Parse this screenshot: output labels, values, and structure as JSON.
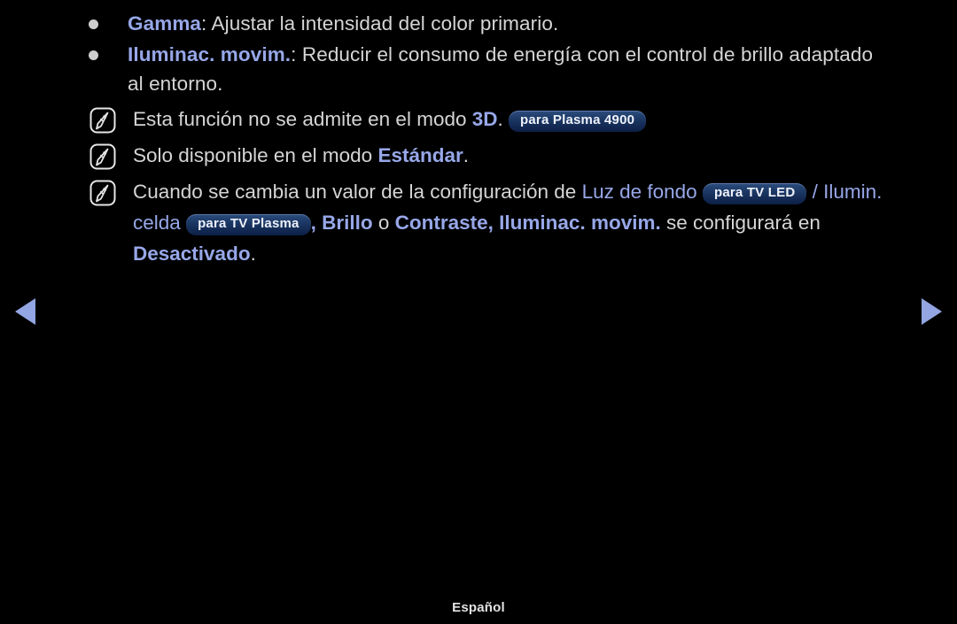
{
  "page": {
    "language_label": "Español",
    "accent_color": "#97a7e8",
    "body_color": "#d5d5d5",
    "background_color": "#000000",
    "badge_color": "#1b3763",
    "arrow_color": "#93a5e2"
  },
  "nav": {
    "prev_label": "◀",
    "next_label": "▶",
    "prev_name": "previous-page-arrow",
    "next_name": "next-page-arrow"
  },
  "bullets": [
    {
      "icon": "bullet-dot",
      "parts": [
        {
          "type": "keyword",
          "text": "Gamma"
        },
        {
          "type": "plain",
          "text": ": Ajustar la intensidad del color primario."
        }
      ]
    },
    {
      "icon": "bullet-dot",
      "parts": [
        {
          "type": "keyword",
          "text": "Iluminac. movim."
        },
        {
          "type": "plain",
          "text": ": Reducir el consumo de energía con el control de brillo adaptado al entorno."
        }
      ]
    }
  ],
  "notes": [
    {
      "icon": "note-pencil-icon",
      "parts": [
        {
          "type": "plain",
          "text": "Esta función no se admite en el modo "
        },
        {
          "type": "keyword",
          "text": "3D"
        },
        {
          "type": "plain",
          "text": ". "
        },
        {
          "type": "badge",
          "text": "para Plasma 4900"
        }
      ]
    },
    {
      "icon": "note-pencil-icon",
      "parts": [
        {
          "type": "plain",
          "text": "Solo disponible en el modo "
        },
        {
          "type": "keyword",
          "text": "Estándar"
        },
        {
          "type": "plain",
          "text": "."
        }
      ]
    },
    {
      "icon": "note-pencil-icon",
      "parts": [
        {
          "type": "plain",
          "text": "Cuando se cambia un valor de la configuración de "
        },
        {
          "type": "keyword-regular",
          "text": "Luz de fondo"
        },
        {
          "type": "badge",
          "text": "para TV LED"
        },
        {
          "type": "keyword-regular",
          "text": " / Ilumin. celda"
        },
        {
          "type": "badge",
          "text": "para TV Plasma"
        },
        {
          "type": "keyword",
          "text": ", Brillo"
        },
        {
          "type": "plain",
          "text": " o "
        },
        {
          "type": "keyword",
          "text": "Contraste"
        },
        {
          "type": "keyword",
          "text": ", Iluminac. movim."
        },
        {
          "type": "plain",
          "text": " se configurará en "
        },
        {
          "type": "keyword",
          "text": "Desactivado"
        },
        {
          "type": "plain",
          "text": "."
        }
      ]
    }
  ],
  "text_runs": {
    "b1_kw": "Gamma",
    "b1_rest": ": Ajustar la intensidad del color primario.",
    "b2_kw": "Iluminac. movim.",
    "b2_rest": ": Reducir el consumo de energía con el control de brillo adaptado al entorno.",
    "n1_a": "Esta función no se admite en el modo ",
    "n1_kw": "3D",
    "n1_b": ".",
    "n1_badge": "para Plasma 4900",
    "n2_a": "Solo disponible en el modo ",
    "n2_kw": "Estándar",
    "n2_b": ".",
    "n3_a": "Cuando se cambia un valor de la configuración de ",
    "n3_kw1": "Luz de fondo",
    "n3_badge1": "para TV LED",
    "n3_kw2": " / Ilumin. celda",
    "n3_badge2": "para TV Plasma",
    "n3_kw3": ", Brillo",
    "n3_mid": " o ",
    "n3_kw4": "Contraste",
    "n3_kw5": ", Iluminac. movim.",
    "n3_b": " se configurará en ",
    "n3_kw6": "Desactivado",
    "n3_c": "."
  }
}
